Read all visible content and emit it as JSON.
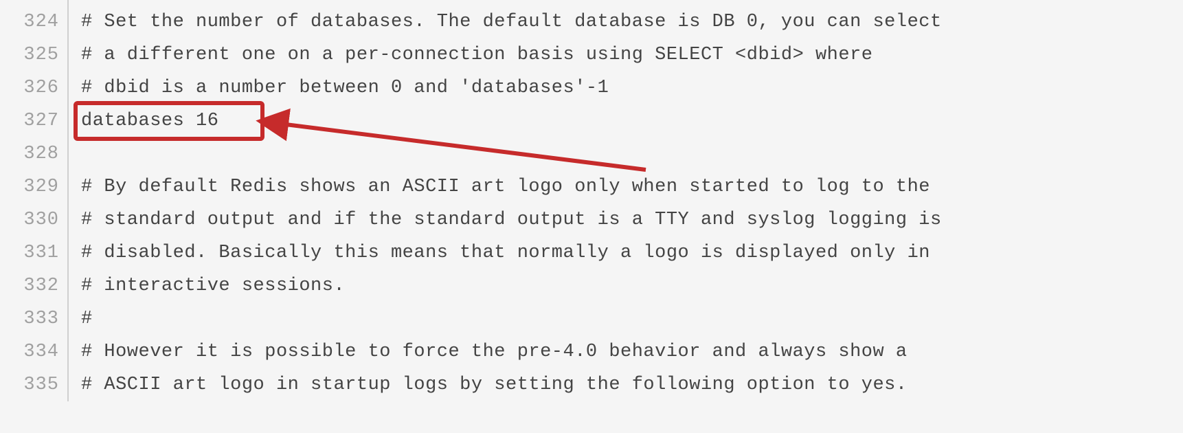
{
  "lines": [
    {
      "num": "",
      "text": ""
    },
    {
      "num": "324",
      "text": "# Set the number of databases. The default database is DB 0, you can select"
    },
    {
      "num": "325",
      "text": "# a different one on a per-connection basis using SELECT <dbid> where"
    },
    {
      "num": "326",
      "text": "# dbid is a number between 0 and 'databases'-1"
    },
    {
      "num": "327",
      "text": "databases 16"
    },
    {
      "num": "328",
      "text": ""
    },
    {
      "num": "329",
      "text": "# By default Redis shows an ASCII art logo only when started to log to the"
    },
    {
      "num": "330",
      "text": "# standard output and if the standard output is a TTY and syslog logging is"
    },
    {
      "num": "331",
      "text": "# disabled. Basically this means that normally a logo is displayed only in"
    },
    {
      "num": "332",
      "text": "# interactive sessions."
    },
    {
      "num": "333",
      "text": "#"
    },
    {
      "num": "334",
      "text": "# However it is possible to force the pre-4.0 behavior and always show a"
    },
    {
      "num": "335",
      "text": "# ASCII art logo in startup logs by setting the following option to yes."
    }
  ],
  "annotation": {
    "highlight_line": "327",
    "highlight_text": "databases 16",
    "highlight_color": "#c62b2b"
  }
}
